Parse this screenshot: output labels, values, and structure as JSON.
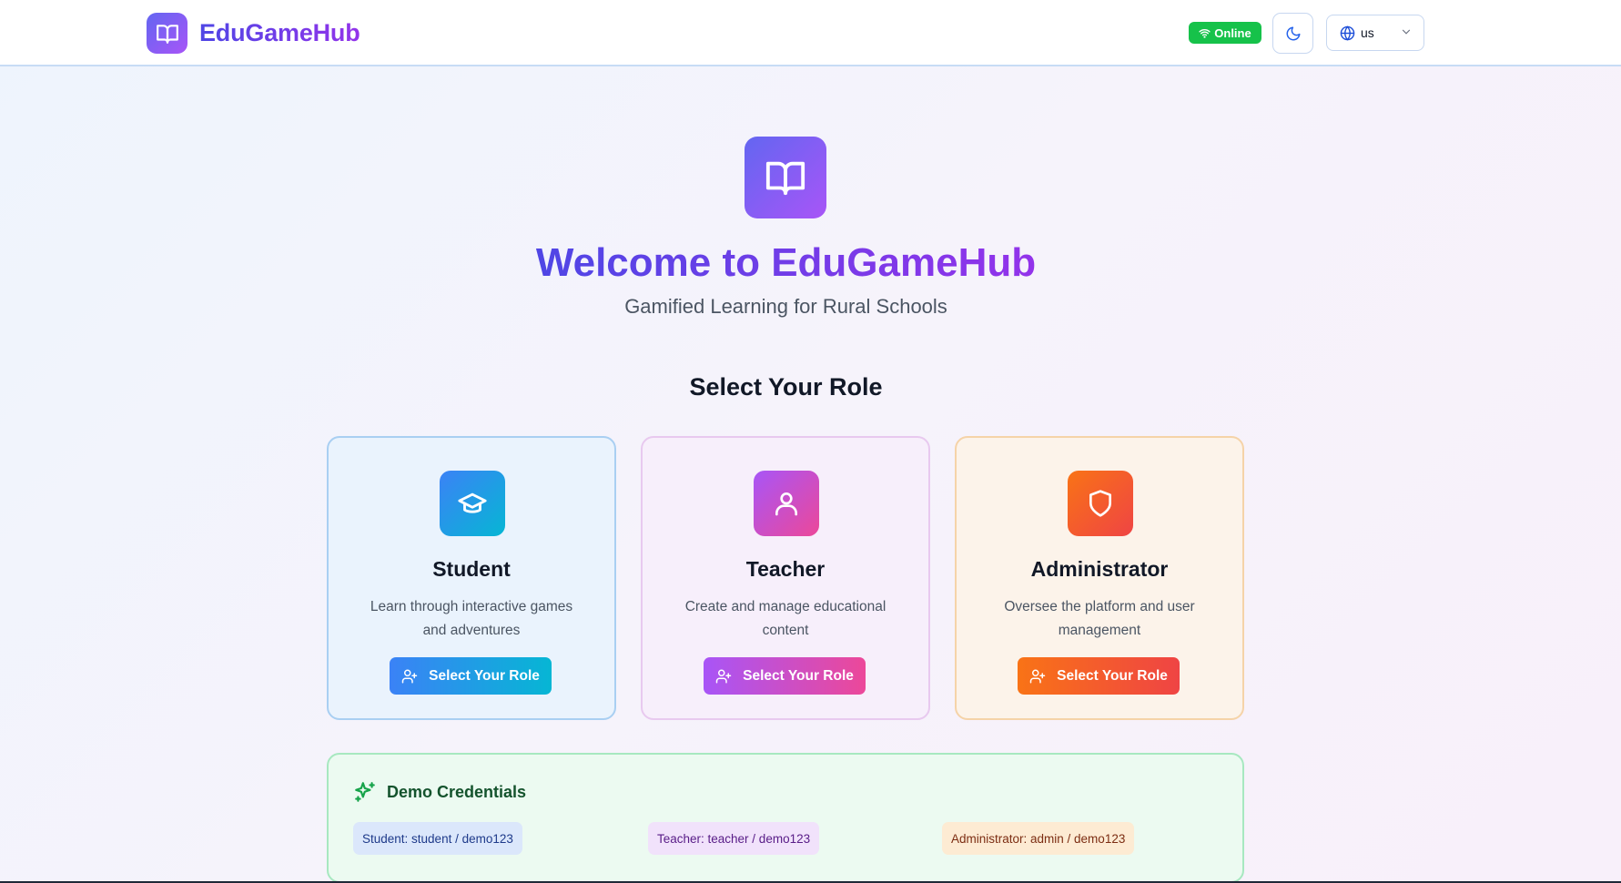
{
  "header": {
    "brand": "EduGameHub",
    "status": "Online",
    "language": "us"
  },
  "hero": {
    "title": "Welcome to EduGameHub",
    "subtitle": "Gamified Learning for Rural Schools"
  },
  "roles_section": {
    "title": "Select Your Role",
    "roles": [
      {
        "name": "Student",
        "desc": "Learn through interactive games and adventures",
        "button": "Select Your Role",
        "icon": "graduation-cap-icon"
      },
      {
        "name": "Teacher",
        "desc": "Create and manage educational content",
        "button": "Select Your Role",
        "icon": "user-icon"
      },
      {
        "name": "Administrator",
        "desc": "Oversee the platform and user management",
        "button": "Select Your Role",
        "icon": "shield-icon"
      }
    ]
  },
  "demo": {
    "title": "Demo Credentials",
    "credentials": [
      "Student: student / demo123",
      "Teacher: teacher / demo123",
      "Administrator: admin / demo123"
    ]
  },
  "colors": {
    "brand_start": "#6366f1",
    "brand_end": "#a855f7",
    "online_green": "#16c24a",
    "student": "#3b82f6",
    "teacher": "#a855f7",
    "admin": "#f97316"
  }
}
